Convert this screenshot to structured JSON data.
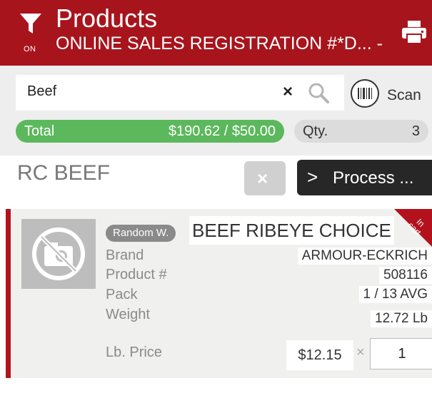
{
  "header": {
    "title": "Products",
    "subtitle": "ONLINE SALES REGISTRATION #*D... -",
    "filter_state": "ON",
    "icons": {
      "filter": "filter-icon",
      "print": "print-icon"
    },
    "background_color": "#a8141c"
  },
  "search": {
    "value": "Beef",
    "clear_symbol": "×",
    "scan_label": "Scan",
    "icons": {
      "search": "search-icon",
      "scan": "barcode-scan-icon"
    }
  },
  "summary": {
    "total_label": "Total",
    "total_value": "$190.62 / $50.00",
    "qty_label": "Qty.",
    "qty_value": "3",
    "total_color": "#5cb85c"
  },
  "category": {
    "title": "RC BEEF",
    "clear_symbol": "×",
    "process_chevron": ">",
    "process_label": "Process ..."
  },
  "product": {
    "badge": "Random W.",
    "name": "BEEF RIBEYE CHOICE",
    "in_cart_label_1": "In",
    "in_cart_label_2": "cart",
    "fields": [
      {
        "label": "Brand",
        "value": "ARMOUR-ECKRICH"
      },
      {
        "label": "Product #",
        "value": "508116"
      },
      {
        "label": "Pack",
        "value": "1 / 13 AVG"
      },
      {
        "label": "Weight",
        "value": "12.72 Lb"
      }
    ],
    "price_label": "Lb. Price",
    "price_value": "$12.15",
    "times_symbol": "×",
    "quantity": "1",
    "accent_color": "#b3121c"
  }
}
